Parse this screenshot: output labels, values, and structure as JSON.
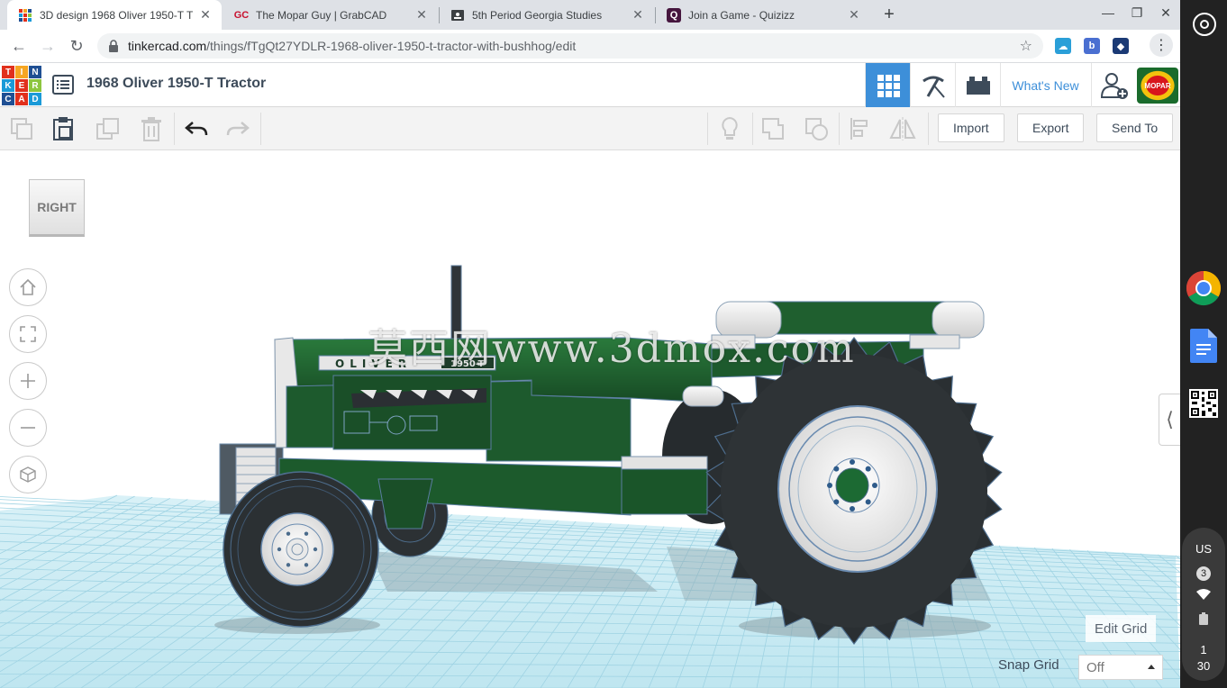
{
  "browser": {
    "tabs": [
      {
        "title": "3D design 1968 Oliver 1950-T Tr",
        "favicon": "tinkercad-icon",
        "active": true
      },
      {
        "title": "The Mopar Guy | GrabCAD",
        "favicon": "GC",
        "active": false
      },
      {
        "title": "5th Period Georgia Studies",
        "favicon": "classroom-icon",
        "active": false
      },
      {
        "title": "Join a Game - Quizizz",
        "favicon": "Q",
        "active": false
      }
    ],
    "url_domain": "tinkercad.com",
    "url_path": "/things/fTgQt27YDLR-1968-oliver-1950-t-tractor-with-bushhog/edit"
  },
  "app": {
    "logo_letters": [
      "T",
      "I",
      "N",
      "K",
      "E",
      "R",
      "C",
      "A",
      "D"
    ],
    "logo_colors": [
      "#e1301c",
      "#f6a623",
      "#1f4f93",
      "#1a9ad8",
      "#e1301c",
      "#8dc63f",
      "#1f4f93",
      "#e1301c",
      "#1a9ad8"
    ],
    "design_title": "1968 Oliver 1950-T Tractor",
    "whats_new": "What's New",
    "avatar_text": "MOPAR",
    "import_label": "Import",
    "export_label": "Export",
    "send_to_label": "Send To",
    "viewcube_label": "RIGHT",
    "edit_grid_label": "Edit Grid",
    "snap_grid_label": "Snap Grid",
    "snap_grid_value": "Off",
    "watermark": "莫西网www.3dmox.com",
    "tractor_badge": "OLIVER",
    "tractor_model": "1950-T"
  },
  "shelf": {
    "locale": "US",
    "notification_count": "3",
    "time_hour": "1",
    "time_minute": "30"
  },
  "colors": {
    "accent": "#3d8fd9",
    "tractor_green": "#1c5a2c",
    "tire": "#2e3336",
    "grid": "#a5dbe9"
  }
}
